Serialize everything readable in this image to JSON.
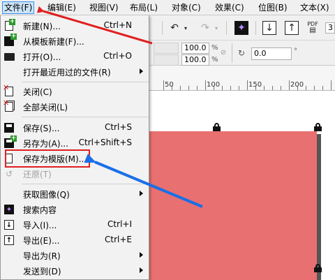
{
  "menubar": {
    "items": [
      {
        "label": "文件(F)"
      },
      {
        "label": "编辑(E)"
      },
      {
        "label": "视图(V)"
      },
      {
        "label": "布局(L)"
      },
      {
        "label": "对象(C)"
      },
      {
        "label": "效果(C)"
      },
      {
        "label": "位图(B)"
      },
      {
        "label": "文本(X)"
      }
    ]
  },
  "toolbar": {
    "pdf_label": "PDF",
    "scale_x": "100.0",
    "scale_y": "100.0",
    "percent": "%",
    "angle": "0.0",
    "degree": "°",
    "pos_x_partial": "3"
  },
  "ruler": {
    "labels": [
      "50",
      "100",
      "150",
      "200"
    ]
  },
  "file_menu": {
    "items": [
      {
        "label": "新建(N)...",
        "shortcut": "Ctrl+N"
      },
      {
        "label": "从模板新建(F)...",
        "shortcut": ""
      },
      {
        "label": "打开(O)...",
        "shortcut": "Ctrl+O"
      },
      {
        "label": "打开最近用过的文件(R)",
        "shortcut": ""
      },
      {
        "label": "关闭(C)",
        "shortcut": ""
      },
      {
        "label": "全部关闭(L)",
        "shortcut": ""
      },
      {
        "label": "保存(S)...",
        "shortcut": "Ctrl+S"
      },
      {
        "label": "另存为(A)...",
        "shortcut": "Ctrl+Shift+S"
      },
      {
        "label": "保存为模版(M)...",
        "shortcut": ""
      },
      {
        "label": "还原(T)",
        "shortcut": ""
      },
      {
        "label": "获取图像(Q)",
        "shortcut": ""
      },
      {
        "label": "搜索内容",
        "shortcut": ""
      },
      {
        "label": "导入(I)...",
        "shortcut": "Ctrl+I"
      },
      {
        "label": "导出(E)...",
        "shortcut": "Ctrl+E"
      },
      {
        "label": "导出为(R)",
        "shortcut": ""
      },
      {
        "label": "发送到(D)",
        "shortcut": ""
      }
    ]
  },
  "colors": {
    "page_fill": "#e87070",
    "highlight_red": "#e02020",
    "arrow_blue": "#1a6fe8",
    "menu_bg": "#f2f2f2"
  }
}
